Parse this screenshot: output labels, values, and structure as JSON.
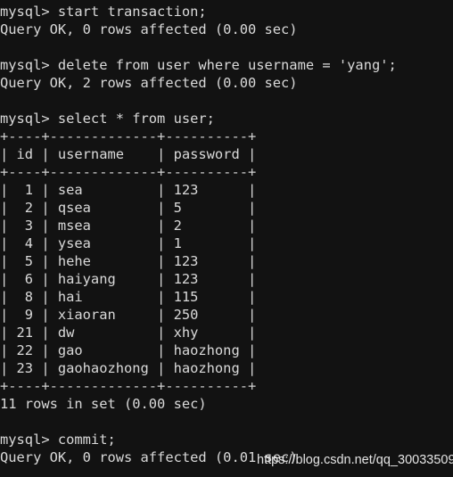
{
  "terminal": {
    "app": "mysql-client-terminal",
    "background_color": "#121212",
    "foreground_color": "#d9d9d9",
    "prompt": "mysql>",
    "lines": [
      "mysql> start transaction;",
      "Query OK, 0 rows affected (0.00 sec)",
      "",
      "mysql> delete from user where username = 'yang';",
      "Query OK, 2 rows affected (0.00 sec)",
      "",
      "mysql> select * from user;",
      "+----+-------------+----------+",
      "| id | username    | password |",
      "+----+-------------+----------+",
      "|  1 | sea         | 123      |",
      "|  2 | qsea        | 5        |",
      "|  3 | msea        | 2        |",
      "|  4 | ysea        | 1        |",
      "|  5 | hehe        | 123      |",
      "|  6 | haiyang     | 123      |",
      "|  8 | hai         | 115      |",
      "|  9 | xiaoran     | 250      |",
      "| 21 | dw          | xhy      |",
      "| 22 | gao         | haozhong |",
      "| 23 | gaohaozhong | haozhong |",
      "+----+-------------+----------+",
      "11 rows in set (0.00 sec)",
      "",
      "mysql> commit;",
      "Query OK, 0 rows affected (0.01 sec)"
    ]
  },
  "commands": [
    {
      "text": "start transaction;",
      "result": "Query OK, 0 rows affected (0.00 sec)"
    },
    {
      "text": "delete from user where username = 'yang';",
      "result": "Query OK, 2 rows affected (0.00 sec)"
    },
    {
      "text": "select * from user;",
      "result": "11 rows in set (0.00 sec)"
    },
    {
      "text": "commit;",
      "result": "Query OK, 0 rows affected (0.01 sec)"
    }
  ],
  "result_table": {
    "columns": [
      "id",
      "username",
      "password"
    ],
    "rows": [
      [
        "1",
        "sea",
        "123"
      ],
      [
        "2",
        "qsea",
        "5"
      ],
      [
        "3",
        "msea",
        "2"
      ],
      [
        "4",
        "ysea",
        "1"
      ],
      [
        "5",
        "hehe",
        "123"
      ],
      [
        "6",
        "haiyang",
        "123"
      ],
      [
        "8",
        "hai",
        "115"
      ],
      [
        "9",
        "xiaoran",
        "250"
      ],
      [
        "21",
        "dw",
        "xhy"
      ],
      [
        "22",
        "gao",
        "haozhong"
      ],
      [
        "23",
        "gaohaozhong",
        "haozhong"
      ]
    ],
    "row_count_text": "11 rows in set (0.00 sec)"
  },
  "watermark": {
    "text": "https://blog.csdn.net/qq_30033509"
  }
}
